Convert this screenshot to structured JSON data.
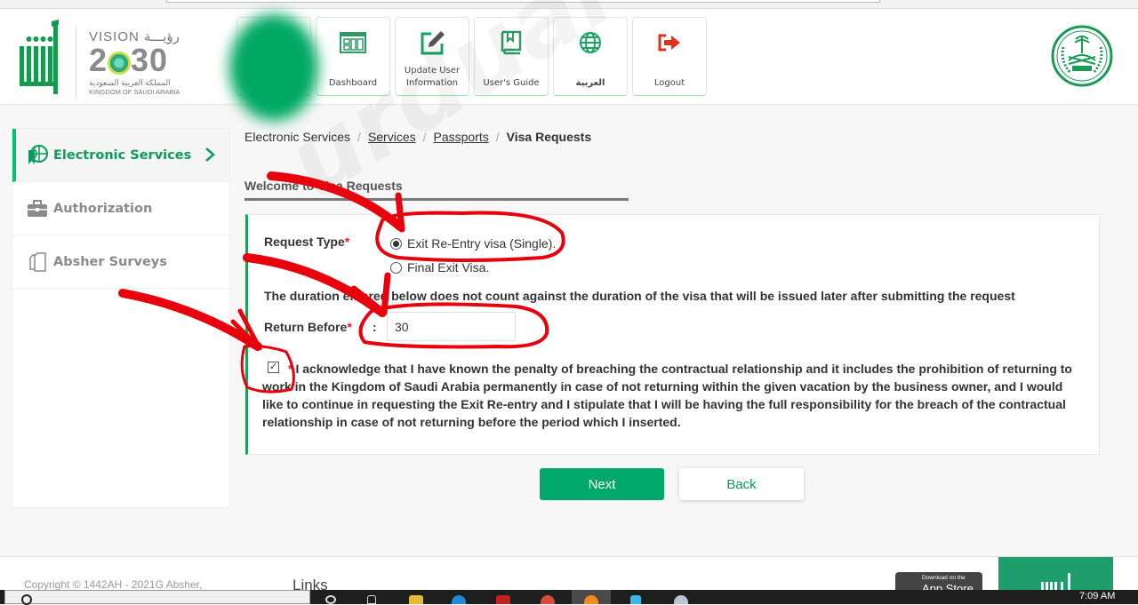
{
  "header": {
    "logo_alt": "Absher",
    "vision": {
      "top": "VISION رؤيـــة",
      "num_left": "2",
      "num_right": "30",
      "arabic": "المملكة العربية السعودية",
      "english": "KINGDOM OF SAUDI ARABIA"
    },
    "tiles": [
      {
        "label": "Dashboard",
        "icon": "dashboard-icon"
      },
      {
        "label": "Update User Information",
        "icon": "edit-icon"
      },
      {
        "label": "User's Guide",
        "icon": "book-icon"
      },
      {
        "label": "العربية",
        "icon": "globe-icon"
      },
      {
        "label": "Logout",
        "icon": "logout-icon"
      }
    ],
    "emblem": "saudi-emblem"
  },
  "sidebar": {
    "items": [
      {
        "label": "Electronic Services",
        "icon": "globe-bookmark-icon",
        "active": true
      },
      {
        "label": "Authorization",
        "icon": "briefcase-icon",
        "active": false
      },
      {
        "label": "Absher Surveys",
        "icon": "documents-icon",
        "active": false
      }
    ]
  },
  "breadcrumb": {
    "items": [
      "Electronic Services",
      "Services",
      "Passports"
    ],
    "current": "Visa Requests",
    "separator": "/"
  },
  "section_title": "Welcome to Visa Requests",
  "form": {
    "request_type_label": "Request Type",
    "required_mark": "*",
    "options": [
      {
        "label": "Exit Re-Entry visa (Single).",
        "checked": true
      },
      {
        "label": "Final Exit Visa.",
        "checked": false
      }
    ],
    "note": "The duration entered below does not count against the duration of the visa that will be issued later after submitting the request",
    "return_before_label": "Return Before",
    "colon": ":",
    "return_before_value": "30",
    "acknowledge_checked": true,
    "acknowledge_text": "I acknowledge that I have known the penalty of breaching the contractual relationship and it includes the prohibition of returning to work in the Kingdom of Saudi Arabia permanently in case of not returning within the given vacation by the business owner, and I would like to continue in requesting the Exit Re-entry and I stipulate that I will be having the full responsibility for the breach of the contractual relationship in case of not returning before the period which I inserted."
  },
  "buttons": {
    "next": "Next",
    "back": "Back"
  },
  "footer": {
    "copyright": "Copyright © 1442AH - 2021G Absher,",
    "links_title": "Links",
    "appstore_small": "Download on the",
    "appstore_big": "App Store"
  },
  "taskbar": {
    "time": "7:09 AM"
  },
  "watermark": "urduarab.com",
  "colors": {
    "brand_green": "#00a86b",
    "sidebar_active": "#0c9b5b",
    "required_red": "#e31c24",
    "annotation_red": "#e8000d"
  }
}
